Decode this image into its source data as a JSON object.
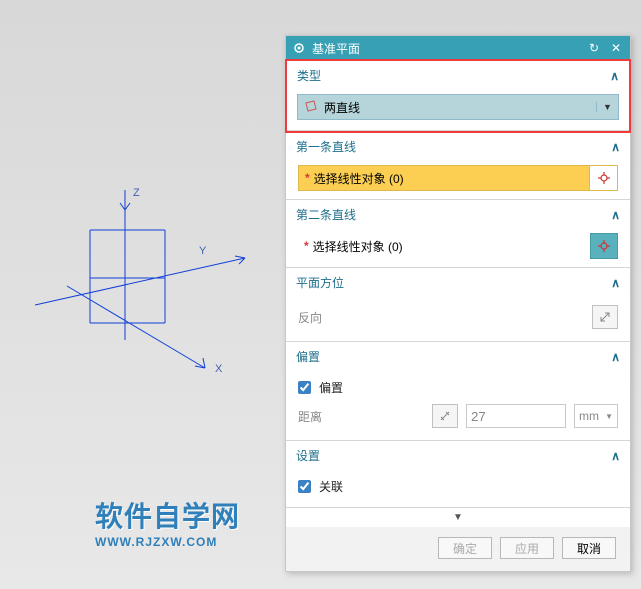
{
  "dialog": {
    "title": "基准平面",
    "sections": {
      "type": {
        "label": "类型",
        "value": "两直线"
      },
      "line1": {
        "label": "第一条直线",
        "select_text": "选择线性对象 (0)"
      },
      "line2": {
        "label": "第二条直线",
        "select_text": "选择线性对象 (0)"
      },
      "orient": {
        "label": "平面方位",
        "reverse": "反向"
      },
      "offset": {
        "label": "偏置",
        "check": "偏置",
        "dist_label": "距离",
        "dist_value": "27",
        "unit": "mm"
      },
      "settings": {
        "label": "设置",
        "assoc": "关联"
      }
    },
    "buttons": {
      "ok": "确定",
      "apply": "应用",
      "cancel": "取消"
    }
  },
  "axes": {
    "x": "X",
    "y": "Y",
    "z": "Z"
  },
  "watermark": {
    "title": "软件自学网",
    "url": "WWW.RJZXW.COM"
  }
}
